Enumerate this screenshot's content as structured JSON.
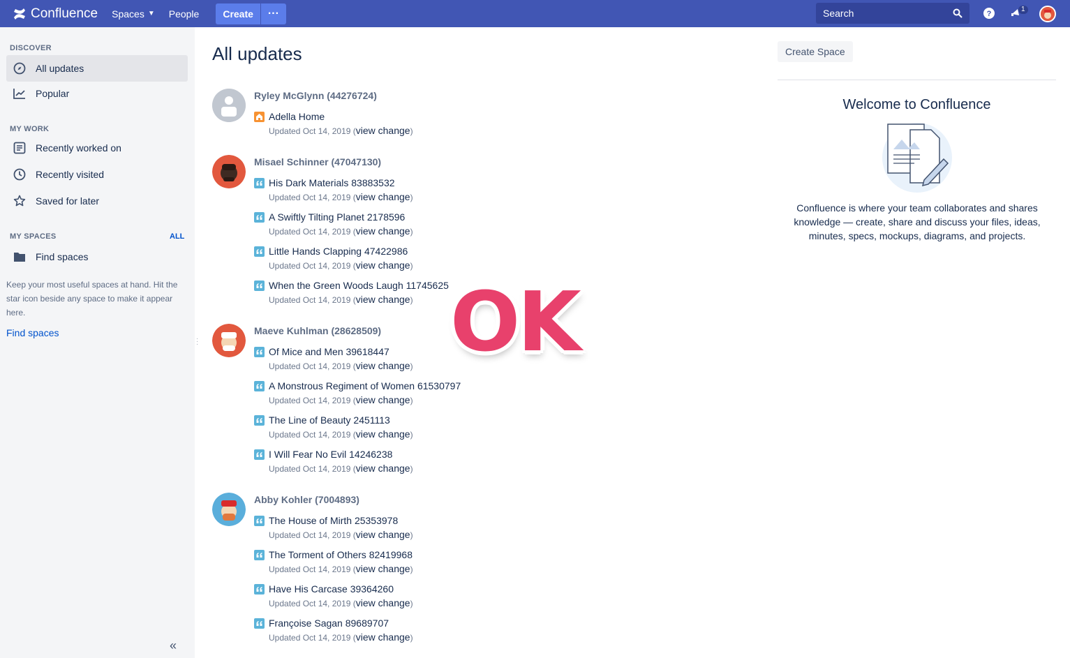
{
  "topnav": {
    "logo": "Confluence",
    "spaces": "Spaces",
    "people": "People",
    "create": "Create",
    "more": "···",
    "search_placeholder": "Search",
    "notification_count": "1"
  },
  "sidebar": {
    "discover_title": "DISCOVER",
    "all_updates": "All updates",
    "popular": "Popular",
    "my_work_title": "MY WORK",
    "recently_worked_on": "Recently worked on",
    "recently_visited": "Recently visited",
    "saved_for_later": "Saved for later",
    "my_spaces_title": "MY SPACES",
    "all_link": "ALL",
    "find_spaces_item": "Find spaces",
    "hint": "Keep your most useful spaces at hand. Hit the star icon beside any space to make it appear here.",
    "find_spaces_link": "Find spaces"
  },
  "main": {
    "title": "All updates",
    "meta_prefix": "Updated Oct 14, 2019 (",
    "meta_link": "view change",
    "meta_suffix": ")",
    "groups": [
      {
        "user": "Ryley McGlynn (44276724)",
        "entries": [
          {
            "title": "Adella Home",
            "type": "home"
          }
        ]
      },
      {
        "user": "Misael Schinner (47047130)",
        "entries": [
          {
            "title": "His Dark Materials 83883532",
            "type": "blog"
          },
          {
            "title": "A Swiftly Tilting Planet 2178596",
            "type": "blog"
          },
          {
            "title": "Little Hands Clapping 47422986",
            "type": "blog"
          },
          {
            "title": "When the Green Woods Laugh 11745625",
            "type": "blog"
          }
        ]
      },
      {
        "user": "Maeve Kuhlman (28628509)",
        "entries": [
          {
            "title": "Of Mice and Men 39618447",
            "type": "blog"
          },
          {
            "title": "A Monstrous Regiment of Women 61530797",
            "type": "blog"
          },
          {
            "title": "The Line of Beauty 2451113",
            "type": "blog"
          },
          {
            "title": "I Will Fear No Evil 14246238",
            "type": "blog"
          }
        ]
      },
      {
        "user": "Abby Kohler (7004893)",
        "entries": [
          {
            "title": "The House of Mirth 25353978",
            "type": "blog"
          },
          {
            "title": "The Torment of Others 82419968",
            "type": "blog"
          },
          {
            "title": "Have His Carcase 39364260",
            "type": "blog"
          },
          {
            "title": "Françoise Sagan 89689707",
            "type": "blog"
          }
        ]
      }
    ]
  },
  "right": {
    "create_space": "Create Space",
    "welcome_title": "Welcome to Confluence",
    "welcome_text": "Confluence is where your team collaborates and shares knowledge — create, share and discuss your files, ideas, minutes, specs, mockups, diagrams, and projects."
  },
  "overlay": {
    "ok": "OK"
  },
  "colors": {
    "nav": "#4156B4",
    "accent": "#0052CC",
    "ok": "#E8416C",
    "blog_icon": "#5BB3D9",
    "home_icon": "#F79232"
  }
}
